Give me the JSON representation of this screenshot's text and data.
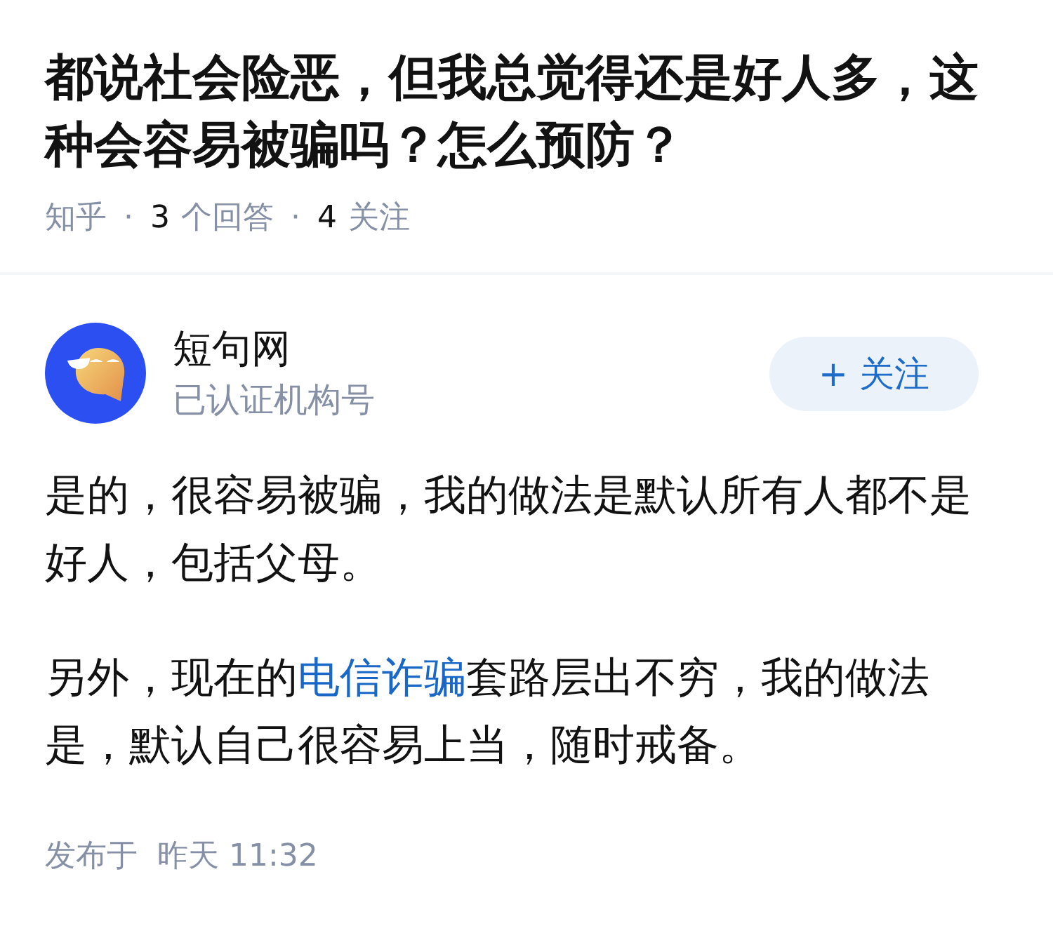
{
  "question": {
    "title": "都说社会险恶，但我总觉得还是好人多，这种会容易被骗吗？怎么预防？",
    "meta": [
      {
        "kind": "label",
        "text": "知乎"
      },
      {
        "kind": "dot",
        "text": "·"
      },
      {
        "kind": "count",
        "text": "3"
      },
      {
        "kind": "label",
        "text": "个回答"
      },
      {
        "kind": "dot",
        "text": "·"
      },
      {
        "kind": "count",
        "text": "4"
      },
      {
        "kind": "label",
        "text": "关注"
      }
    ]
  },
  "author": {
    "name": "短句网",
    "badge": "已认证机构号",
    "follow_button": {
      "label": "+ 关注"
    }
  },
  "answer": {
    "paragraphs": [
      [
        {
          "kind": "text",
          "text": "是的，很容易被骗，我的做法是默认所有人都不是好人，包括父母。"
        }
      ],
      [
        {
          "kind": "text",
          "text": "另外，现在的"
        },
        {
          "kind": "link",
          "text": "电信诈骗"
        },
        {
          "kind": "text",
          "text": "套路层出不穷，我的做法是，默认自己很容易上当，随时戒备。"
        }
      ]
    ],
    "published": "发布于  昨天 11:32"
  }
}
